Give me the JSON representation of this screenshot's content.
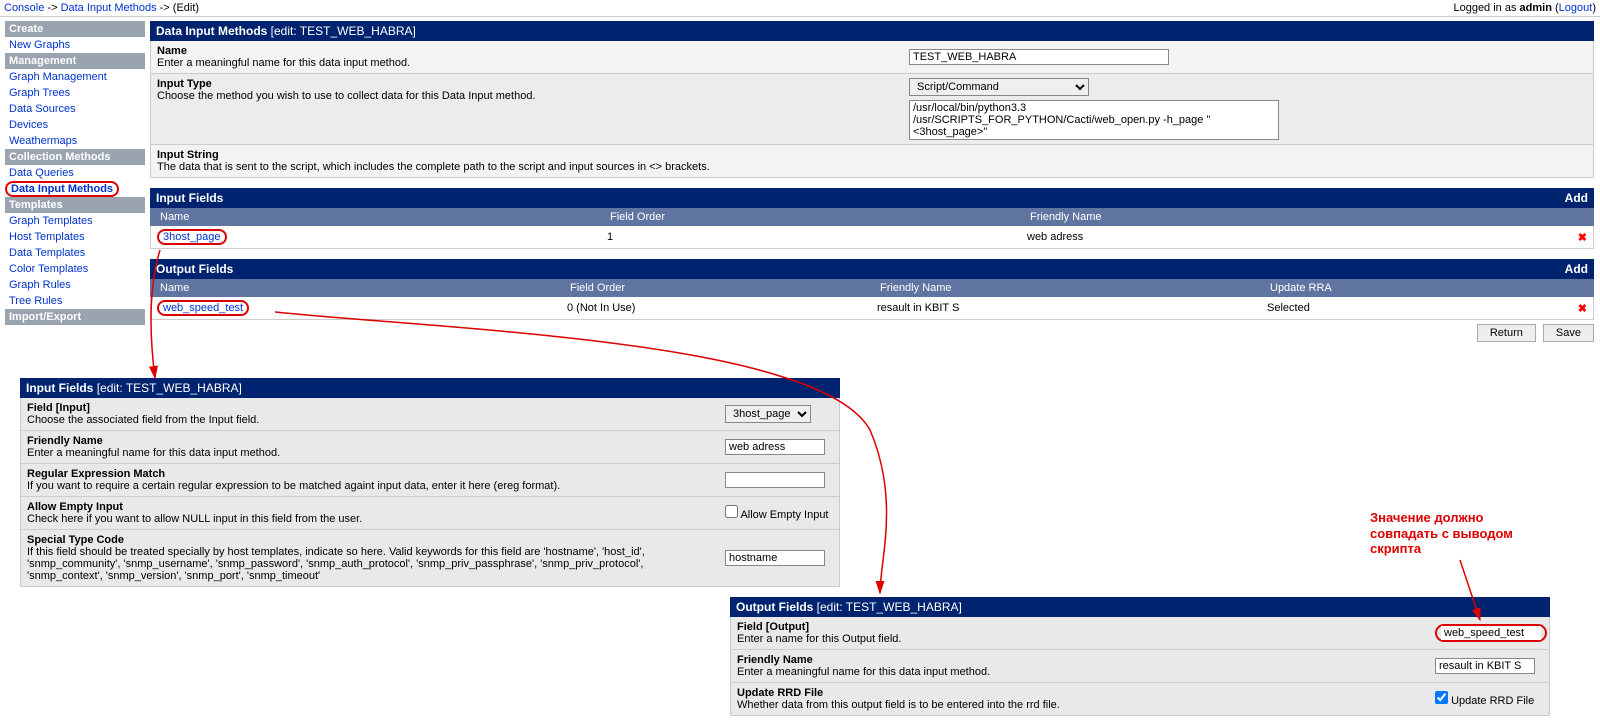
{
  "breadcrumb": {
    "console": "Console",
    "dim": "Data Input Methods",
    "edit": "(Edit)",
    "logged_in_prefix": "Logged in as",
    "user": "admin",
    "logout": "Logout"
  },
  "sidebar": {
    "sections": [
      {
        "title": "Create",
        "links": [
          {
            "label": "New Graphs"
          }
        ]
      },
      {
        "title": "Management",
        "links": [
          {
            "label": "Graph Management"
          },
          {
            "label": "Graph Trees"
          },
          {
            "label": "Data Sources"
          },
          {
            "label": "Devices"
          },
          {
            "label": "Weathermaps"
          }
        ]
      },
      {
        "title": "Collection Methods",
        "links": [
          {
            "label": "Data Queries"
          },
          {
            "label": "Data Input Methods",
            "active": true
          }
        ]
      },
      {
        "title": "Templates",
        "links": [
          {
            "label": "Graph Templates"
          },
          {
            "label": "Host Templates"
          },
          {
            "label": "Data Templates"
          },
          {
            "label": "Color Templates"
          },
          {
            "label": "Graph Rules"
          },
          {
            "label": "Tree Rules"
          }
        ]
      },
      {
        "title": "Import/Export",
        "links": []
      }
    ]
  },
  "dim": {
    "header": "Data Input Methods",
    "edit_suffix": "[edit: TEST_WEB_HABRA]",
    "name_label": "Name",
    "name_hint": "Enter a meaningful name for this data input method.",
    "name_value": "TEST_WEB_HABRA",
    "type_label": "Input Type",
    "type_hint": "Choose the method you wish to use to collect data for this Data Input method.",
    "type_value": "Script/Command",
    "string_label": "Input String",
    "string_hint": "The data that is sent to the script, which includes the complete path to the script and input sources in <> brackets.",
    "string_value": "/usr/local/bin/python3.3 /usr/SCRIPTS_FOR_PYTHON/Cacti/web_open.py -h_page \"<3host_page>\""
  },
  "input_fields": {
    "header": "Input Fields",
    "add": "Add",
    "col_name": "Name",
    "col_order": "Field Order",
    "col_friendly": "Friendly Name",
    "row": {
      "name": "3host_page",
      "order": "1",
      "friendly": "web adress"
    }
  },
  "output_fields": {
    "header": "Output Fields",
    "add": "Add",
    "col_name": "Name",
    "col_order": "Field Order",
    "col_friendly": "Friendly Name",
    "col_rra": "Update RRA",
    "row": {
      "name": "web_speed_test",
      "order": "0 (Not In Use)",
      "friendly": "resault in KBIT S",
      "rra": "Selected"
    }
  },
  "buttons": {
    "return": "Return",
    "save": "Save"
  },
  "edit_input": {
    "header": "Input Fields",
    "suffix": "[edit: TEST_WEB_HABRA]",
    "field_label": "Field [Input]",
    "field_hint": "Choose the associated field from the Input field.",
    "field_value": "3host_page",
    "friendly_label": "Friendly Name",
    "friendly_hint": "Enter a meaningful name for this data input method.",
    "friendly_value": "web adress",
    "regex_label": "Regular Expression Match",
    "regex_hint": "If you want to require a certain regular expression to be matched againt input data, enter it here (ereg format).",
    "allow_label": "Allow Empty Input",
    "allow_hint": "Check here if you want to allow NULL input in this field from the user.",
    "allow_cb": "Allow Empty Input",
    "special_label": "Special Type Code",
    "special_hint": "If this field should be treated specially by host templates, indicate so here. Valid keywords for this field are 'hostname', 'host_id', 'snmp_community', 'snmp_username', 'snmp_password', 'snmp_auth_protocol', 'snmp_priv_passphrase', 'snmp_priv_protocol', 'snmp_context', 'snmp_version', 'snmp_port', 'snmp_timeout'",
    "special_value": "hostname"
  },
  "edit_output": {
    "header": "Output Fields",
    "suffix": "[edit: TEST_WEB_HABRA]",
    "field_label": "Field [Output]",
    "field_hint": "Enter a name for this Output field.",
    "field_value": "web_speed_test",
    "friendly_label": "Friendly Name",
    "friendly_hint": "Enter a meaningful name for this data input method.",
    "friendly_value": "resault in KBIT S",
    "rrd_label": "Update RRD File",
    "rrd_hint": "Whether data from this output field is to be entered into the rrd file.",
    "rrd_cb": "Update RRD File"
  },
  "annotation": "Значение должно совпадать с выводом скрипта"
}
